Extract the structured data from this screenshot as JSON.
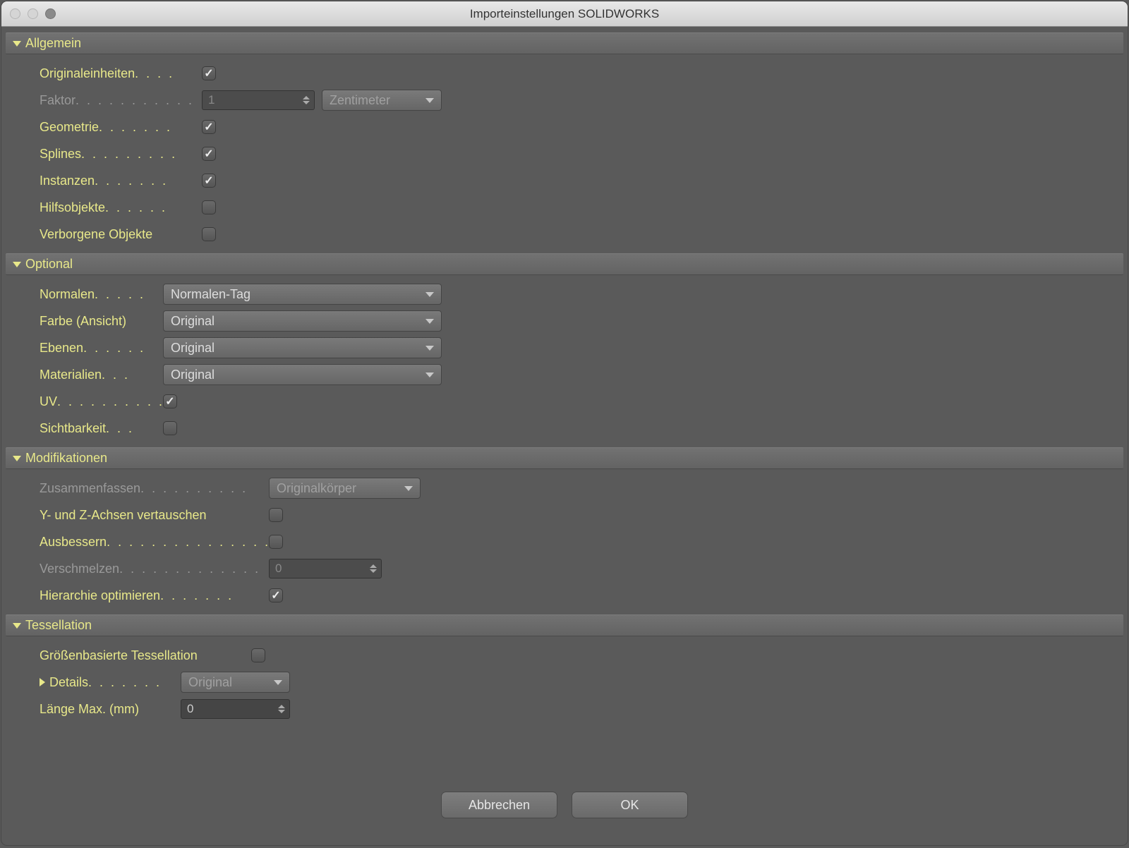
{
  "title": "Importeinstellungen SOLIDWORKS",
  "sections": {
    "allgemein": {
      "header": "Allgemein",
      "originaleinheiten": "Originaleinheiten",
      "faktor": "Faktor",
      "faktor_value": "1",
      "faktor_unit": "Zentimeter",
      "geometrie": "Geometrie",
      "splines": "Splines",
      "instanzen": "Instanzen",
      "hilfsobjekte": "Hilfsobjekte",
      "verborgene": "Verborgene Objekte"
    },
    "optional": {
      "header": "Optional",
      "normalen": "Normalen",
      "normalen_value": "Normalen-Tag",
      "farbe": "Farbe (Ansicht)",
      "farbe_value": "Original",
      "ebenen": "Ebenen",
      "ebenen_value": "Original",
      "materialien": "Materialien",
      "materialien_value": "Original",
      "uv": "UV",
      "sichtbarkeit": "Sichtbarkeit"
    },
    "modifikationen": {
      "header": "Modifikationen",
      "zusammenfassen": "Zusammenfassen",
      "zusammenfassen_value": "Originalkörper",
      "yz": "Y- und Z-Achsen vertauschen",
      "ausbessern": "Ausbessern",
      "verschmelzen": "Verschmelzen",
      "verschmelzen_value": "0",
      "hierarchie": "Hierarchie optimieren"
    },
    "tessellation": {
      "header": "Tessellation",
      "groessen": "Größenbasierte Tessellation",
      "details": "Details",
      "details_value": "Original",
      "laenge": "Länge Max. (mm)",
      "laenge_value": "0"
    }
  },
  "buttons": {
    "cancel": "Abbrechen",
    "ok": "OK"
  }
}
